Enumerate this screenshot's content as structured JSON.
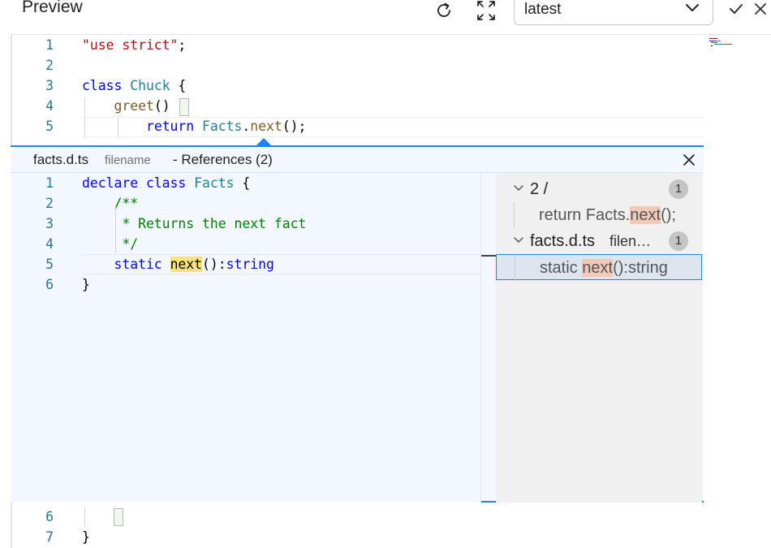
{
  "header": {
    "title": "Preview",
    "version_select": {
      "value": "latest"
    }
  },
  "editor": {
    "top_lines": [
      {
        "num": "1",
        "tokens": [
          {
            "t": "\"use strict\"",
            "c": "str"
          },
          {
            "t": ";",
            "c": "plain"
          }
        ]
      },
      {
        "num": "2",
        "tokens": []
      },
      {
        "num": "3",
        "tokens": [
          {
            "t": "class ",
            "c": "kw"
          },
          {
            "t": "Chuck",
            "c": "cls"
          },
          {
            "t": " {",
            "c": "plain"
          }
        ]
      },
      {
        "num": "4",
        "tokens": [
          {
            "t": "    ",
            "c": "plain"
          },
          {
            "t": "greet",
            "c": "fn"
          },
          {
            "t": "() {",
            "c": "plain"
          }
        ]
      },
      {
        "num": "5",
        "tokens": [
          {
            "t": "        ",
            "c": "plain"
          },
          {
            "t": "return ",
            "c": "kw"
          },
          {
            "t": "Facts",
            "c": "cls"
          },
          {
            "t": ".",
            "c": "plain"
          },
          {
            "t": "next",
            "c": "fn"
          },
          {
            "t": "();",
            "c": "plain"
          }
        ]
      }
    ],
    "bottom_lines": [
      {
        "num": "6",
        "tokens": [
          {
            "t": "    }",
            "c": "plain"
          }
        ]
      },
      {
        "num": "7",
        "tokens": [
          {
            "t": "}",
            "c": "plain"
          }
        ]
      }
    ]
  },
  "peek": {
    "file_name": "facts.d.ts",
    "file_path": "filename",
    "title": "- References (2)",
    "lines": [
      {
        "num": "1",
        "tokens": [
          {
            "t": "declare class ",
            "c": "kw"
          },
          {
            "t": "Facts",
            "c": "cls"
          },
          {
            "t": " {",
            "c": "plain"
          }
        ]
      },
      {
        "num": "2",
        "tokens": [
          {
            "t": "    /**",
            "c": "cmt"
          }
        ]
      },
      {
        "num": "3",
        "tokens": [
          {
            "t": "     * Returns the next fact",
            "c": "cmt"
          }
        ]
      },
      {
        "num": "4",
        "tokens": [
          {
            "t": "     */",
            "c": "cmt"
          }
        ]
      },
      {
        "num": "5",
        "tokens": [
          {
            "t": "    static ",
            "c": "kw"
          },
          {
            "t": "next",
            "c": "plain hl-next"
          },
          {
            "t": "():",
            "c": "plain"
          },
          {
            "t": "string",
            "c": "kw"
          }
        ]
      },
      {
        "num": "6",
        "tokens": [
          {
            "t": "}",
            "c": "plain"
          }
        ]
      }
    ],
    "tree": [
      {
        "kind": "group",
        "label": "2 /",
        "count": "1"
      },
      {
        "kind": "ref",
        "before": "return Facts.",
        "match": "next",
        "after": "();"
      },
      {
        "kind": "group",
        "label": "facts.d.ts",
        "detail": "filen…",
        "count": "1"
      },
      {
        "kind": "ref",
        "before": "static ",
        "match": "next",
        "after": "():string",
        "selected": true
      }
    ]
  },
  "icons": {
    "refresh": "refresh-icon",
    "expand": "expand-icon",
    "dropdown": "chevron-down-icon",
    "confirm": "check-icon",
    "dismiss": "close-icon"
  },
  "colors": {
    "accent": "#1a85ff",
    "match_highlight": "#f8e07a",
    "reference_highlight": "#f2c8b8"
  }
}
